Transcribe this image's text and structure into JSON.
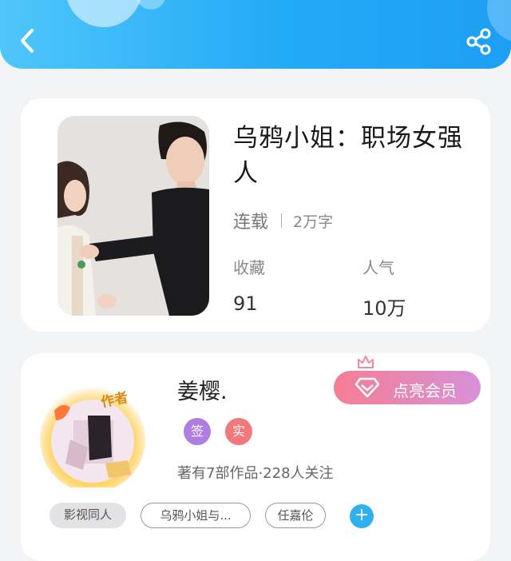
{
  "header": {
    "back_icon": "chevron-left-icon",
    "share_icon": "share-icon",
    "color": "#23aaf6"
  },
  "book": {
    "title": "乌鸦小姐：职场女强人",
    "status": "连载",
    "word_count": "2万字",
    "favorites_label": "收藏",
    "favorites_value": "91",
    "popularity_label": "人气",
    "popularity_value": "10万"
  },
  "author": {
    "name": "姜樱.",
    "avatar_badge": "作者",
    "vip_button": "点亮会员",
    "badges": [
      "签",
      "实"
    ],
    "works_info": "著有7部作品·228人关注"
  },
  "tags": [
    "影视同人",
    "乌鸦小姐与...",
    "任嘉伦"
  ],
  "add_tag": "+"
}
